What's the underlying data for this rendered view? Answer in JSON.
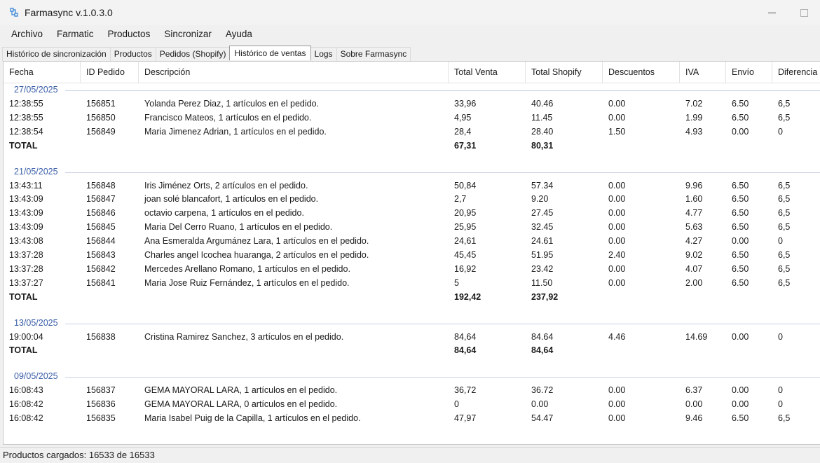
{
  "window": {
    "title": "Farmasync v.1.0.3.0"
  },
  "menu": [
    "Archivo",
    "Farmatic",
    "Productos",
    "Sincronizar",
    "Ayuda"
  ],
  "tabs": [
    {
      "label": "Histórico de sincronización",
      "active": false
    },
    {
      "label": "Productos",
      "active": false
    },
    {
      "label": "Pedidos (Shopify)",
      "active": false
    },
    {
      "label": "Histórico de ventas",
      "active": true
    },
    {
      "label": "Logs",
      "active": false
    },
    {
      "label": "Sobre Farmasync",
      "active": false
    }
  ],
  "table": {
    "columns": [
      "Fecha",
      "ID Pedido",
      "Descripción",
      "Total Venta",
      "Total Shopify",
      "Descuentos",
      "IVA",
      "Envío",
      "Diferencia"
    ],
    "total_label": "TOTAL",
    "groups": [
      {
        "date": "27/05/2025",
        "rows": [
          [
            "12:38:55",
            "156851",
            "Yolanda Perez Diaz, 1 artículos en el pedido.",
            "33,96",
            "40.46",
            "0.00",
            "7.02",
            "6.50",
            "6,5"
          ],
          [
            "12:38:55",
            "156850",
            "Francisco Mateos, 1 artículos en el pedido.",
            "4,95",
            "11.45",
            "0.00",
            "1.99",
            "6.50",
            "6,5"
          ],
          [
            "12:38:54",
            "156849",
            "Maria Jimenez Adrian, 1 artículos en el pedido.",
            "28,4",
            "28.40",
            "1.50",
            "4.93",
            "0.00",
            "0"
          ]
        ],
        "total_venta": "67,31",
        "total_shopify": "80,31"
      },
      {
        "date": "21/05/2025",
        "rows": [
          [
            "13:43:11",
            "156848",
            "Iris Jiménez Orts, 2 artículos en el pedido.",
            "50,84",
            "57.34",
            "0.00",
            "9.96",
            "6.50",
            "6,5"
          ],
          [
            "13:43:09",
            "156847",
            "joan solé blancafort, 1 artículos en el pedido.",
            "2,7",
            "9.20",
            "0.00",
            "1.60",
            "6.50",
            "6,5"
          ],
          [
            "13:43:09",
            "156846",
            "octavio carpena, 1 artículos en el pedido.",
            "20,95",
            "27.45",
            "0.00",
            "4.77",
            "6.50",
            "6,5"
          ],
          [
            "13:43:09",
            "156845",
            "Maria Del Cerro Ruano, 1 artículos en el pedido.",
            "25,95",
            "32.45",
            "0.00",
            "5.63",
            "6.50",
            "6,5"
          ],
          [
            "13:43:08",
            "156844",
            "Ana Esmeralda Argumánez Lara, 1 artículos en el pedido.",
            "24,61",
            "24.61",
            "0.00",
            "4.27",
            "0.00",
            "0"
          ],
          [
            "13:37:28",
            "156843",
            "Charles angel Icochea huaranga, 2 artículos en el pedido.",
            "45,45",
            "51.95",
            "2.40",
            "9.02",
            "6.50",
            "6,5"
          ],
          [
            "13:37:28",
            "156842",
            "Mercedes Arellano Romano, 1 artículos en el pedido.",
            "16,92",
            "23.42",
            "0.00",
            "4.07",
            "6.50",
            "6,5"
          ],
          [
            "13:37:27",
            "156841",
            "Maria Jose Ruiz Fernández, 1 artículos en el pedido.",
            "5",
            "11.50",
            "0.00",
            "2.00",
            "6.50",
            "6,5"
          ]
        ],
        "total_venta": "192,42",
        "total_shopify": "237,92"
      },
      {
        "date": "13/05/2025",
        "rows": [
          [
            "19:00:04",
            "156838",
            "Cristina Ramirez Sanchez, 3 artículos en el pedido.",
            "84,64",
            "84.64",
            "4.46",
            "14.69",
            "0.00",
            "0"
          ]
        ],
        "total_venta": "84,64",
        "total_shopify": "84,64"
      },
      {
        "date": "09/05/2025",
        "rows": [
          [
            "16:08:43",
            "156837",
            "GEMA MAYORAL LARA, 1 artículos en el pedido.",
            "36,72",
            "36.72",
            "0.00",
            "6.37",
            "0.00",
            "0"
          ],
          [
            "16:08:42",
            "156836",
            "GEMA MAYORAL LARA, 0 artículos en el pedido.",
            "0",
            "0.00",
            "0.00",
            "0.00",
            "0.00",
            "0"
          ],
          [
            "16:08:42",
            "156835",
            "Maria Isabel Puig de la Capilla, 1 artículos en el pedido.",
            "47,97",
            "54.47",
            "0.00",
            "9.46",
            "6.50",
            "6,5"
          ]
        ]
      }
    ]
  },
  "status": {
    "text": "Productos cargados: 16533 de 16533"
  },
  "colors": {
    "group_date": "#3a5ea8",
    "app_icon": "#4a90d9"
  },
  "icons": {
    "app": "molecule-icon"
  }
}
